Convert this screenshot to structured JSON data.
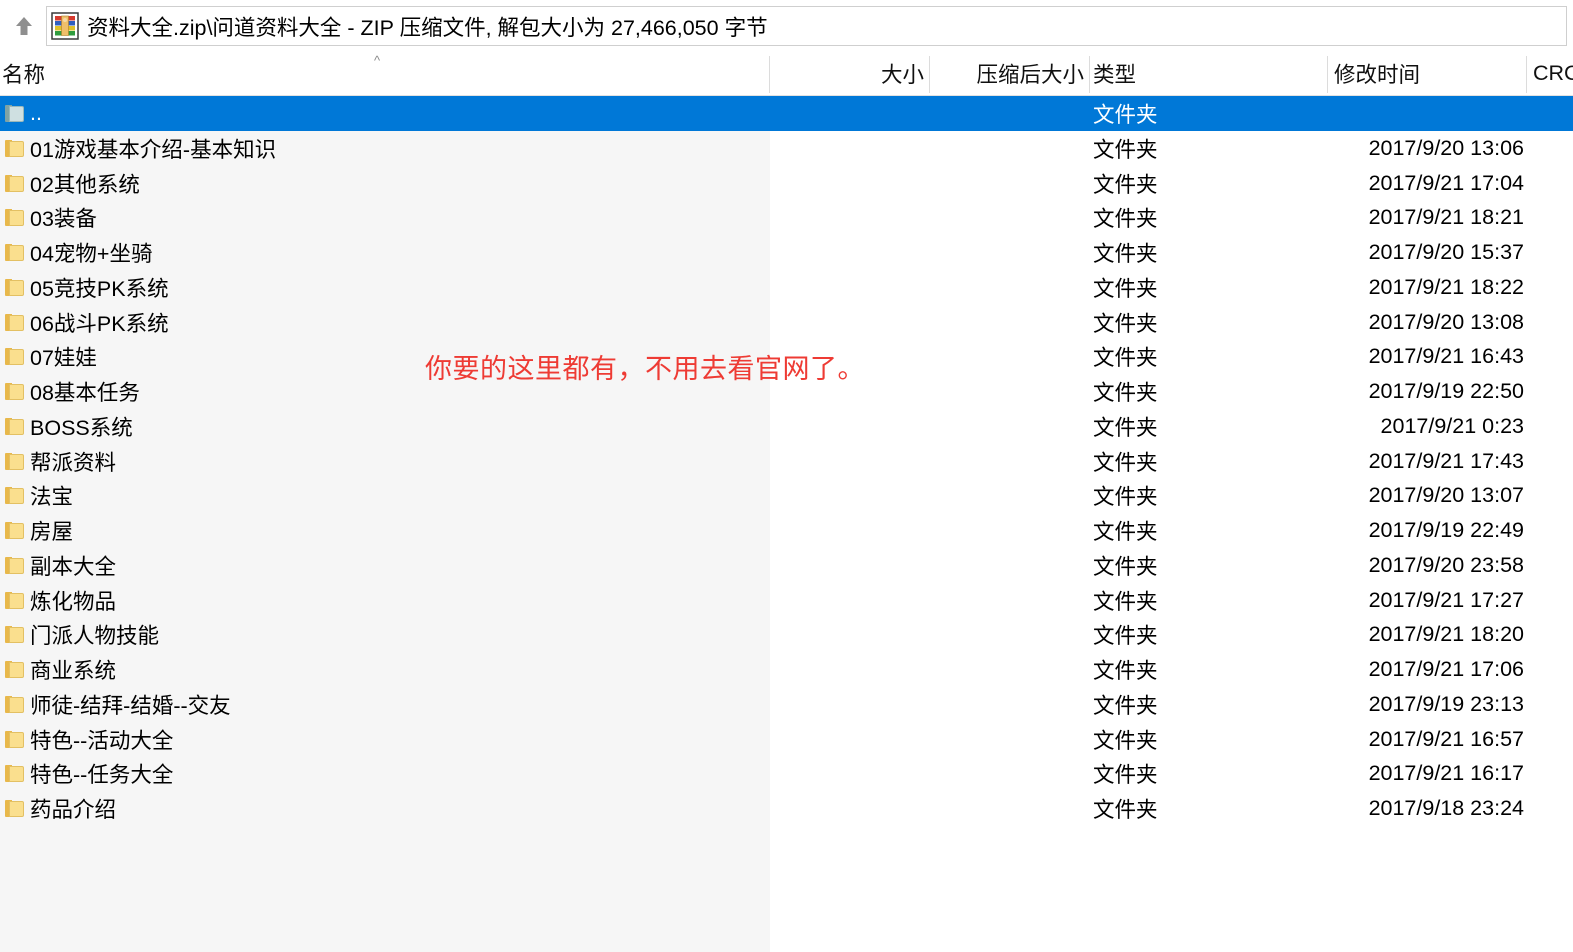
{
  "titlebar": {
    "up_button_label": "↑",
    "archive_icon": "winrar-archive-icon",
    "path_text": "资料大全.zip\\问道资料大全 - ZIP 压缩文件, 解包大小为 27,466,050 字节"
  },
  "columns": {
    "name": "名称",
    "size": "大小",
    "packed_size": "压缩后大小",
    "type": "类型",
    "modified": "修改时间",
    "crc": "CRC",
    "sort_indicator": "^",
    "sort_column": "名称",
    "sort_direction": "ascending"
  },
  "colors": {
    "selection": "#0078d7",
    "annotation": "#ee3b34",
    "name_column_bg": "#f6f6f6",
    "folder_yellow": "#fadf8e",
    "parent_folder_teal": "#cfe0e1"
  },
  "annotation": {
    "text": "你要的这里都有，不用去看官网了。"
  },
  "rows": [
    {
      "name": "..",
      "size": "",
      "packed": "",
      "type": "文件夹",
      "modified": "",
      "icon": "parent-folder-icon",
      "selected": true
    },
    {
      "name": "01游戏基本介绍-基本知识",
      "size": "",
      "packed": "",
      "type": "文件夹",
      "modified": "2017/9/20 13:06",
      "icon": "folder-icon",
      "selected": false
    },
    {
      "name": "02其他系统",
      "size": "",
      "packed": "",
      "type": "文件夹",
      "modified": "2017/9/21 17:04",
      "icon": "folder-icon",
      "selected": false
    },
    {
      "name": "03装备",
      "size": "",
      "packed": "",
      "type": "文件夹",
      "modified": "2017/9/21 18:21",
      "icon": "folder-icon",
      "selected": false
    },
    {
      "name": "04宠物+坐骑",
      "size": "",
      "packed": "",
      "type": "文件夹",
      "modified": "2017/9/20 15:37",
      "icon": "folder-icon",
      "selected": false
    },
    {
      "name": "05竞技PK系统",
      "size": "",
      "packed": "",
      "type": "文件夹",
      "modified": "2017/9/21 18:22",
      "icon": "folder-icon",
      "selected": false
    },
    {
      "name": "06战斗PK系统",
      "size": "",
      "packed": "",
      "type": "文件夹",
      "modified": "2017/9/20 13:08",
      "icon": "folder-icon",
      "selected": false
    },
    {
      "name": "07娃娃",
      "size": "",
      "packed": "",
      "type": "文件夹",
      "modified": "2017/9/21 16:43",
      "icon": "folder-icon",
      "selected": false
    },
    {
      "name": "08基本任务",
      "size": "",
      "packed": "",
      "type": "文件夹",
      "modified": "2017/9/19 22:50",
      "icon": "folder-icon",
      "selected": false
    },
    {
      "name": "BOSS系统",
      "size": "",
      "packed": "",
      "type": "文件夹",
      "modified": "2017/9/21 0:23",
      "icon": "folder-icon",
      "selected": false
    },
    {
      "name": "帮派资料",
      "size": "",
      "packed": "",
      "type": "文件夹",
      "modified": "2017/9/21 17:43",
      "icon": "folder-icon",
      "selected": false
    },
    {
      "name": "法宝",
      "size": "",
      "packed": "",
      "type": "文件夹",
      "modified": "2017/9/20 13:07",
      "icon": "folder-icon",
      "selected": false
    },
    {
      "name": "房屋",
      "size": "",
      "packed": "",
      "type": "文件夹",
      "modified": "2017/9/19 22:49",
      "icon": "folder-icon",
      "selected": false
    },
    {
      "name": "副本大全",
      "size": "",
      "packed": "",
      "type": "文件夹",
      "modified": "2017/9/20 23:58",
      "icon": "folder-icon",
      "selected": false
    },
    {
      "name": "炼化物品",
      "size": "",
      "packed": "",
      "type": "文件夹",
      "modified": "2017/9/21 17:27",
      "icon": "folder-icon",
      "selected": false
    },
    {
      "name": "门派人物技能",
      "size": "",
      "packed": "",
      "type": "文件夹",
      "modified": "2017/9/21 18:20",
      "icon": "folder-icon",
      "selected": false
    },
    {
      "name": "商业系统",
      "size": "",
      "packed": "",
      "type": "文件夹",
      "modified": "2017/9/21 17:06",
      "icon": "folder-icon",
      "selected": false
    },
    {
      "name": "师徒-结拜-结婚--交友",
      "size": "",
      "packed": "",
      "type": "文件夹",
      "modified": "2017/9/19 23:13",
      "icon": "folder-icon",
      "selected": false
    },
    {
      "name": "特色--活动大全",
      "size": "",
      "packed": "",
      "type": "文件夹",
      "modified": "2017/9/21 16:57",
      "icon": "folder-icon",
      "selected": false
    },
    {
      "name": "特色--任务大全",
      "size": "",
      "packed": "",
      "type": "文件夹",
      "modified": "2017/9/21 16:17",
      "icon": "folder-icon",
      "selected": false
    },
    {
      "name": "药品介绍",
      "size": "",
      "packed": "",
      "type": "文件夹",
      "modified": "2017/9/18 23:24",
      "icon": "folder-icon",
      "selected": false
    }
  ]
}
